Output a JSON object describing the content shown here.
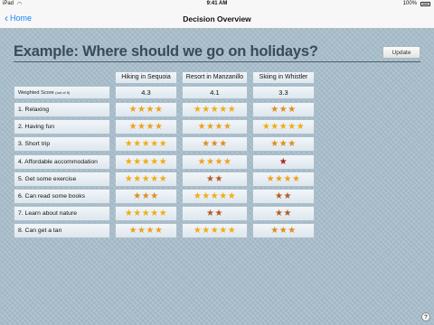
{
  "status_bar": {
    "device": "iPad",
    "time": "9:41 AM",
    "battery": "100%"
  },
  "nav": {
    "back_label": "Home",
    "title": "Decision Overview"
  },
  "page": {
    "title": "Example: Where should we go on holidays?",
    "update_label": "Update",
    "help_label": "?"
  },
  "table": {
    "score_label": "Weighted Score",
    "score_scale": "(out of 5)",
    "options": [
      {
        "name": "Hiking in Sequoia",
        "score": "4.3"
      },
      {
        "name": "Resort in Manzanillo",
        "score": "4.1"
      },
      {
        "name": "Skiing in Whistler",
        "score": "3.3"
      }
    ],
    "criteria": [
      {
        "label": "1. Relaxing",
        "ratings": [
          4,
          5,
          3
        ]
      },
      {
        "label": "2. Having fun",
        "ratings": [
          4,
          4,
          5
        ]
      },
      {
        "label": "3. Short trip",
        "ratings": [
          5,
          3,
          3
        ]
      },
      {
        "label": "4. Affordable accommodation",
        "ratings": [
          5,
          4,
          1
        ]
      },
      {
        "label": "5. Get some exercise",
        "ratings": [
          5,
          2,
          4
        ]
      },
      {
        "label": "6. Can read some books",
        "ratings": [
          3,
          5,
          2
        ]
      },
      {
        "label": "7. Learn about nature",
        "ratings": [
          5,
          2,
          2
        ]
      },
      {
        "label": "8. Can get a tan",
        "ratings": [
          4,
          5,
          3
        ]
      }
    ]
  },
  "star_colors": {
    "5": "#f2ad13",
    "4": "#f0a020",
    "3": "#e08c1c",
    "2": "#b85a1d",
    "1": "#a8241c"
  }
}
